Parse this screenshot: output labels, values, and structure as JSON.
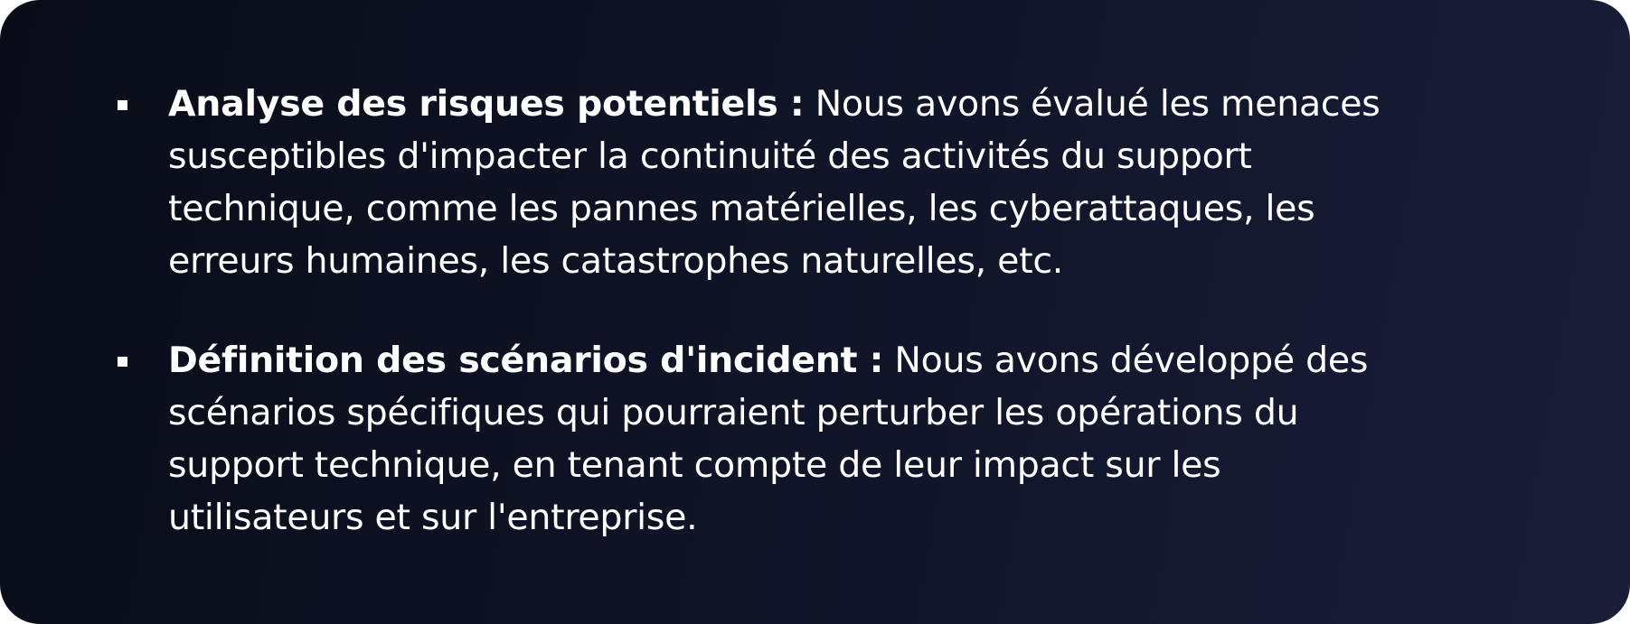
{
  "items": [
    {
      "title": "Analyse des risques potentiels :",
      "lines": [
        " Nous avons évalué les menaces",
        "susceptibles d'impacter la continuité des activités du support",
        "technique, comme les pannes matérielles, les cyberattaques, les",
        "erreurs humaines, les catastrophes naturelles, etc."
      ]
    },
    {
      "title": "Définition des scénarios d'incident :",
      "lines": [
        " Nous avons développé des",
        "scénarios spécifiques qui pourraient perturber les opérations du",
        "support technique, en tenant compte de leur impact sur les",
        "utilisateurs et sur l'entreprise."
      ]
    }
  ],
  "colors": {
    "background_start": "#090c18",
    "background_end": "#181e38",
    "text": "#ffffff"
  }
}
